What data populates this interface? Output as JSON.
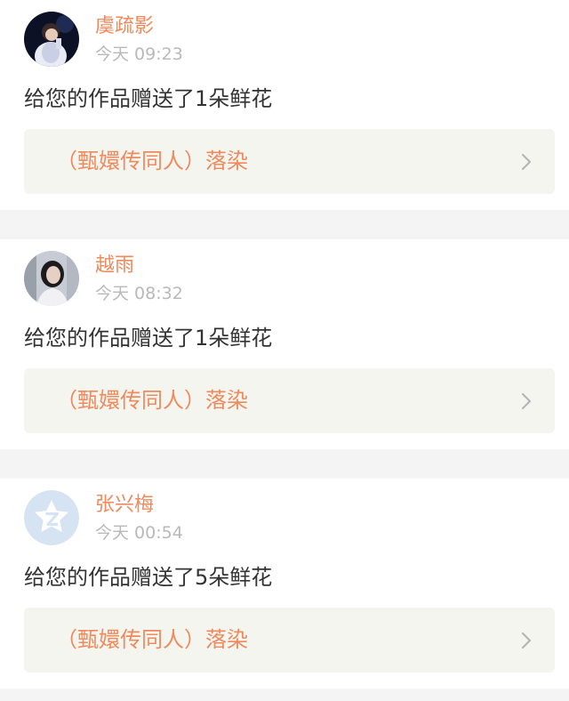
{
  "notifications": [
    {
      "user": "虞疏影",
      "time": "今天 09:23",
      "message": "给您的作品赠送了1朵鲜花",
      "work_title": "（甄嬛传同人）落染"
    },
    {
      "user": "越雨",
      "time": "今天 08:32",
      "message": "给您的作品赠送了1朵鲜花",
      "work_title": "（甄嬛传同人）落染"
    },
    {
      "user": "张兴梅",
      "time": "今天 00:54",
      "message": "给您的作品赠送了5朵鲜花",
      "work_title": "（甄嬛传同人）落染"
    }
  ],
  "icons": {
    "chevron": "chevron-right-icon",
    "default_avatar": "default-avatar-icon"
  },
  "colors": {
    "accent": "#f08a5d",
    "muted": "#b9b9b9",
    "text": "#333333",
    "link_bg": "#f5f5ef",
    "page_bg": "#f4f4f4"
  }
}
